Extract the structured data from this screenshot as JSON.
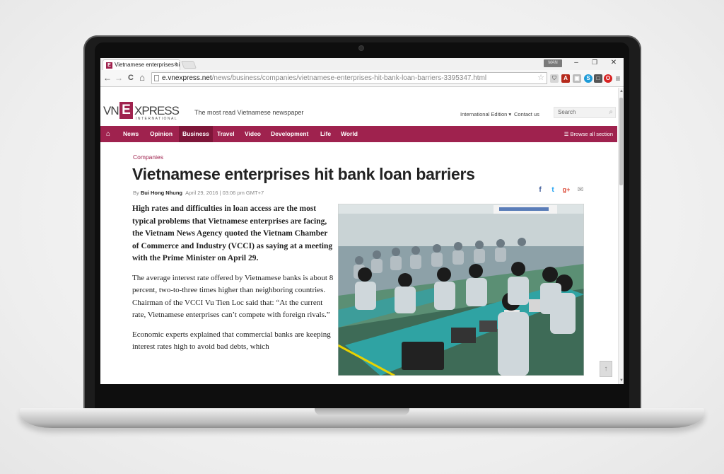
{
  "browser": {
    "tab_title": "Vietnamese enterprises hi",
    "tab_close": "×",
    "user_badge": "MAN",
    "url_host": "e.vnexpress.net",
    "url_path": "/news/business/companies/vietnamese-enterprises-hit-bank-loan-barriers-3395347.html",
    "back": "←",
    "forward": "→",
    "reload": "C",
    "home": "⌂",
    "star": "☆",
    "menu": "≡",
    "minimize": "–",
    "maximize": "❐",
    "close": "✕"
  },
  "site": {
    "logo_vn": "VN",
    "logo_e": "E",
    "logo_xpress": "XPRESS",
    "logo_intl": "INTERNATIONAL",
    "tagline": "The most read Vietnamese newspaper",
    "intl_edition": "International Edition ▾",
    "contact": "Contact us",
    "search_placeholder": "Search",
    "nav": [
      "News",
      "Opinion",
      "Business",
      "Travel",
      "Video",
      "Development",
      "Life",
      "World"
    ],
    "active_nav": "Business",
    "browse_all": "☰ Browse all section"
  },
  "article": {
    "category": "Companies",
    "headline": "Vietnamese enterprises hit bank loan barriers",
    "by_prefix": "By ",
    "author": "Bui Hong Nhung",
    "date": "April 29, 2016 | 03:06 pm GMT+7",
    "lead": "High rates and difficulties in loan access are the most typical problems that Vietnamese enterprises are facing, the Vietnam News Agency quoted the Vietnam Chamber of Commerce and Industry (VCCI) as saying at a meeting with the Prime Minister on April 29.",
    "para1": "The average interest rate offered by Vietnamese banks is about 8 percent, two-to-three times higher than neighboring countries. Chairman of the VCCI Vu Tien Loc said that: “At the current rate, Vietnamese enterprises can’t compete with foreign rivals.”",
    "para2": "Economic experts explained that commercial banks are keeping interest rates high to avoid bad debts, which"
  },
  "social": {
    "facebook": "f",
    "twitter": "t",
    "google": "g+",
    "email": "✉"
  },
  "scroll_top": "↑",
  "colors": {
    "brand": "#9f224e",
    "brand_dark": "#7e1639"
  }
}
